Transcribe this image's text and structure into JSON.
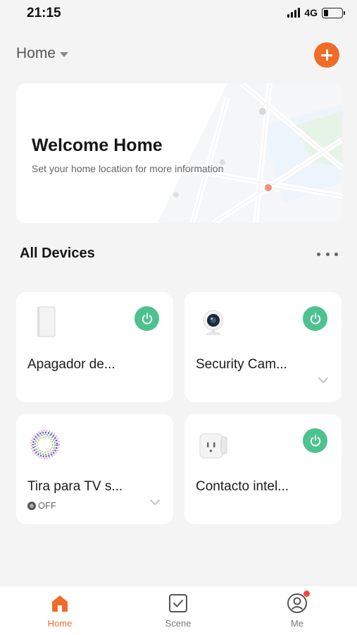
{
  "status_bar": {
    "time": "21:15",
    "network": "4G",
    "battery_level": 0.25
  },
  "header": {
    "home_label": "Home"
  },
  "welcome": {
    "title": "Welcome Home",
    "subtitle": "Set your home location for more information"
  },
  "devices_section": {
    "title": "All Devices"
  },
  "devices": [
    {
      "name": "Apagador de...",
      "icon": "wall-switch-icon",
      "power_on": true
    },
    {
      "name": "Security Cam...",
      "icon": "security-camera-icon",
      "power_on": true,
      "expandable": true
    },
    {
      "name": "Tira para TV s...",
      "icon": "led-strip-icon",
      "status": "OFF",
      "expandable": true
    },
    {
      "name": "Contacto intel...",
      "icon": "smart-plug-icon",
      "power_on": true
    }
  ],
  "tabs": [
    {
      "label": "Home",
      "icon": "home-icon",
      "active": true
    },
    {
      "label": "Scene",
      "icon": "scene-checkbox-icon",
      "active": false
    },
    {
      "label": "Me",
      "icon": "profile-icon",
      "active": false,
      "notification": true
    }
  ],
  "colors": {
    "accent": "#f06b2a",
    "power_on": "#4cc28f",
    "background": "#f4f4f4",
    "badge": "#f04a3a"
  }
}
